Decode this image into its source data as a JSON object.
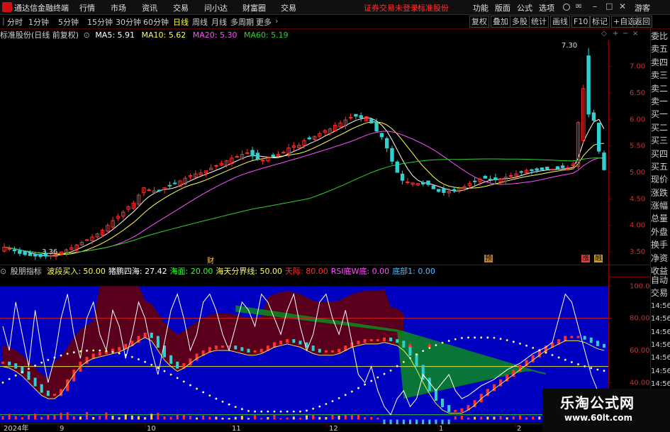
{
  "titlebar": {
    "app_name": "通达信金融终端",
    "menus": [
      "行情",
      "市场",
      "资讯",
      "交易",
      "问小达",
      "财富圈",
      "交易"
    ],
    "alert_text": "证券交易未登录",
    "stock_name": "标准股份",
    "right_menus": [
      "功能",
      "版面",
      "公式",
      "选项"
    ],
    "guest": "游客"
  },
  "toolbar": {
    "periods": [
      "分时",
      "1分钟",
      "5分钟",
      "15分钟",
      "30分钟",
      "60分钟",
      "日线",
      "周线",
      "月线",
      "多周期",
      "更多"
    ],
    "active_period": "日线",
    "right_buttons": [
      "复权",
      "叠加",
      "多股",
      "统计",
      "画线",
      "F10",
      "标记",
      "+自选",
      "返回"
    ]
  },
  "main_header": {
    "title": "标准股份(日线 前复权)",
    "ma5": "MA5: 5.91",
    "ma10": "MA10: 5.62",
    "ma20": "MA20: 5.30",
    "ma60": "MA60: 5.19"
  },
  "sub_header": {
    "title": "股朋指标",
    "items": [
      {
        "text": "波段买入: 50.00",
        "color": "#ffff50"
      },
      {
        "text": "猪鹏四海: 27.42",
        "color": "#ffffff"
      },
      {
        "text": "海面: 20.00",
        "color": "#30ff30"
      },
      {
        "text": "海天分界线: 50.00",
        "color": "#ffff50"
      },
      {
        "text": "天际: 80.00",
        "color": "#ff3030"
      },
      {
        "text": "RSI底W底: 0.00",
        "color": "#ff50ff"
      },
      {
        "text": "底部1: 0.00",
        "color": "#50c0ff"
      }
    ]
  },
  "main_axis": {
    "ticks": [
      "7.00",
      "6.50",
      "6.00",
      "5.50",
      "5.00",
      "4.50",
      "4.00",
      "3.50"
    ]
  },
  "sub_axis": {
    "ticks": [
      "100.0",
      "80.00",
      "60.00",
      "40.00",
      "20.00"
    ]
  },
  "annotations": {
    "high": "7.30",
    "low": "3.36",
    "cai": "财",
    "yu": "预",
    "zhang": "涨",
    "rong": "融"
  },
  "time_axis": {
    "labels": [
      "2024年",
      "9",
      "10",
      "11",
      "12",
      "1",
      "2"
    ]
  },
  "sidebar_top": [
    "委比",
    "卖五",
    "卖四",
    "卖三",
    "卖二",
    "卖一",
    "买一",
    "买二",
    "买三",
    "买四",
    "买五",
    "现价",
    "涨跌",
    "涨幅",
    "总量",
    "外盘",
    "换手",
    "净资",
    "收益"
  ],
  "sidebar_bottom": [
    "自动",
    "交易",
    "14:56",
    "14:56",
    "14:56",
    "14:56",
    "14:56",
    "14:56",
    "14:56",
    "14:56"
  ],
  "watermark": {
    "cn": "乐淘公式网",
    "url": "www.60lt.com"
  },
  "colors": {
    "up": "#ff3030",
    "down": "#30d0d0",
    "ma5": "#ffffff",
    "ma10": "#ffff50",
    "ma20": "#ff50ff",
    "ma60": "#30d030",
    "panel_bg": "#0000c0"
  },
  "chart_data": [
    {
      "type": "candlestick",
      "title": "标准股份(日线 前复权)",
      "y_range": [
        3.3,
        7.45
      ],
      "closes": [
        3.59,
        3.56,
        3.52,
        3.47,
        3.45,
        3.43,
        3.42,
        3.41,
        3.42,
        3.43,
        3.47,
        3.5,
        3.54,
        3.58,
        3.63,
        3.68,
        3.73,
        3.78,
        3.84,
        3.91,
        4.0,
        4.09,
        4.17,
        4.25,
        4.35,
        4.42,
        4.57,
        4.71,
        4.67,
        4.65,
        4.66,
        4.71,
        4.75,
        4.79,
        4.84,
        4.89,
        4.94,
        4.97,
        4.99,
        5.03,
        5.08,
        5.13,
        5.17,
        5.22,
        5.27,
        5.3,
        5.34,
        5.37,
        5.31,
        5.25,
        5.23,
        5.28,
        5.3,
        5.34,
        5.38,
        5.46,
        5.5,
        5.51,
        5.6,
        5.63,
        5.68,
        5.73,
        5.79,
        5.82,
        5.89,
        5.93,
        5.99,
        6.04,
        6.06,
        6.03,
        6.05,
        5.93,
        5.78,
        5.67,
        5.46,
        5.21,
        5.0,
        4.85,
        4.82,
        4.8,
        4.79,
        4.78,
        4.77,
        4.69,
        4.64,
        4.62,
        4.64,
        4.66,
        4.7,
        4.73,
        4.79,
        4.83,
        4.87,
        4.89,
        4.87,
        4.86,
        4.88,
        4.91,
        4.94,
        4.97,
        5.0,
        5.04,
        5.03,
        5.04,
        5.05,
        5.06,
        5.06,
        5.07,
        5.09,
        5.09,
        5.16,
        5.94,
        6.58,
        6.1,
        5.98,
        5.4,
        5.05
      ],
      "ma": [
        {
          "name": "MA5",
          "value": "5.91"
        },
        {
          "name": "MA10",
          "value": "5.62"
        },
        {
          "name": "MA20",
          "value": "5.30"
        },
        {
          "name": "MA60",
          "value": "5.19"
        }
      ]
    },
    {
      "type": "line",
      "title": "股朋指标",
      "y_range": [
        15,
        101
      ],
      "reference_lines": [
        {
          "name": "天际",
          "value": 80
        },
        {
          "name": "海天分界线",
          "value": 50
        },
        {
          "name": "海面",
          "value": 20
        }
      ],
      "series": [
        {
          "name": "波段买入",
          "values": [
            50,
            49,
            47,
            44,
            40,
            36,
            32,
            30,
            30,
            33,
            39,
            45,
            50,
            53,
            55,
            56,
            57,
            58,
            59,
            61,
            63,
            66,
            68,
            66,
            60,
            54,
            50,
            47,
            49,
            52,
            55,
            57,
            59,
            60,
            60,
            60,
            59,
            58,
            57,
            57,
            58,
            60,
            62,
            63,
            64,
            63,
            62,
            60,
            58,
            57,
            57,
            57,
            58,
            60,
            62,
            63,
            64,
            64,
            64,
            65,
            64,
            63,
            60,
            55,
            48,
            40,
            33,
            27,
            23,
            20,
            20,
            21,
            23,
            26,
            30,
            33,
            36,
            39,
            42,
            45,
            48,
            51,
            54,
            57,
            60,
            62,
            64,
            66,
            66,
            66,
            65,
            63,
            61,
            60
          ]
        },
        {
          "name": "猪鹏四海",
          "values": [
            75,
            60,
            90,
            70,
            50,
            85,
            60,
            40,
            55,
            80,
            95,
            70,
            55,
            80,
            90,
            70,
            60,
            85,
            75,
            55,
            70,
            90,
            80,
            60,
            45,
            65,
            85,
            95,
            80,
            60,
            70,
            90,
            95,
            85,
            70,
            60,
            75,
            90,
            85,
            75,
            95,
            90,
            80,
            70,
            85,
            95,
            75,
            60,
            70,
            90,
            95,
            80,
            70,
            85,
            65,
            45,
            40,
            50,
            35,
            25,
            20,
            30,
            35,
            25,
            30,
            45,
            40,
            35,
            40,
            45,
            35,
            30,
            32,
            35,
            38,
            40,
            42,
            45,
            48,
            50,
            52,
            55,
            58,
            60,
            62,
            65,
            80,
            95,
            90,
            75,
            60,
            45,
            35,
            27
          ]
        }
      ]
    }
  ]
}
